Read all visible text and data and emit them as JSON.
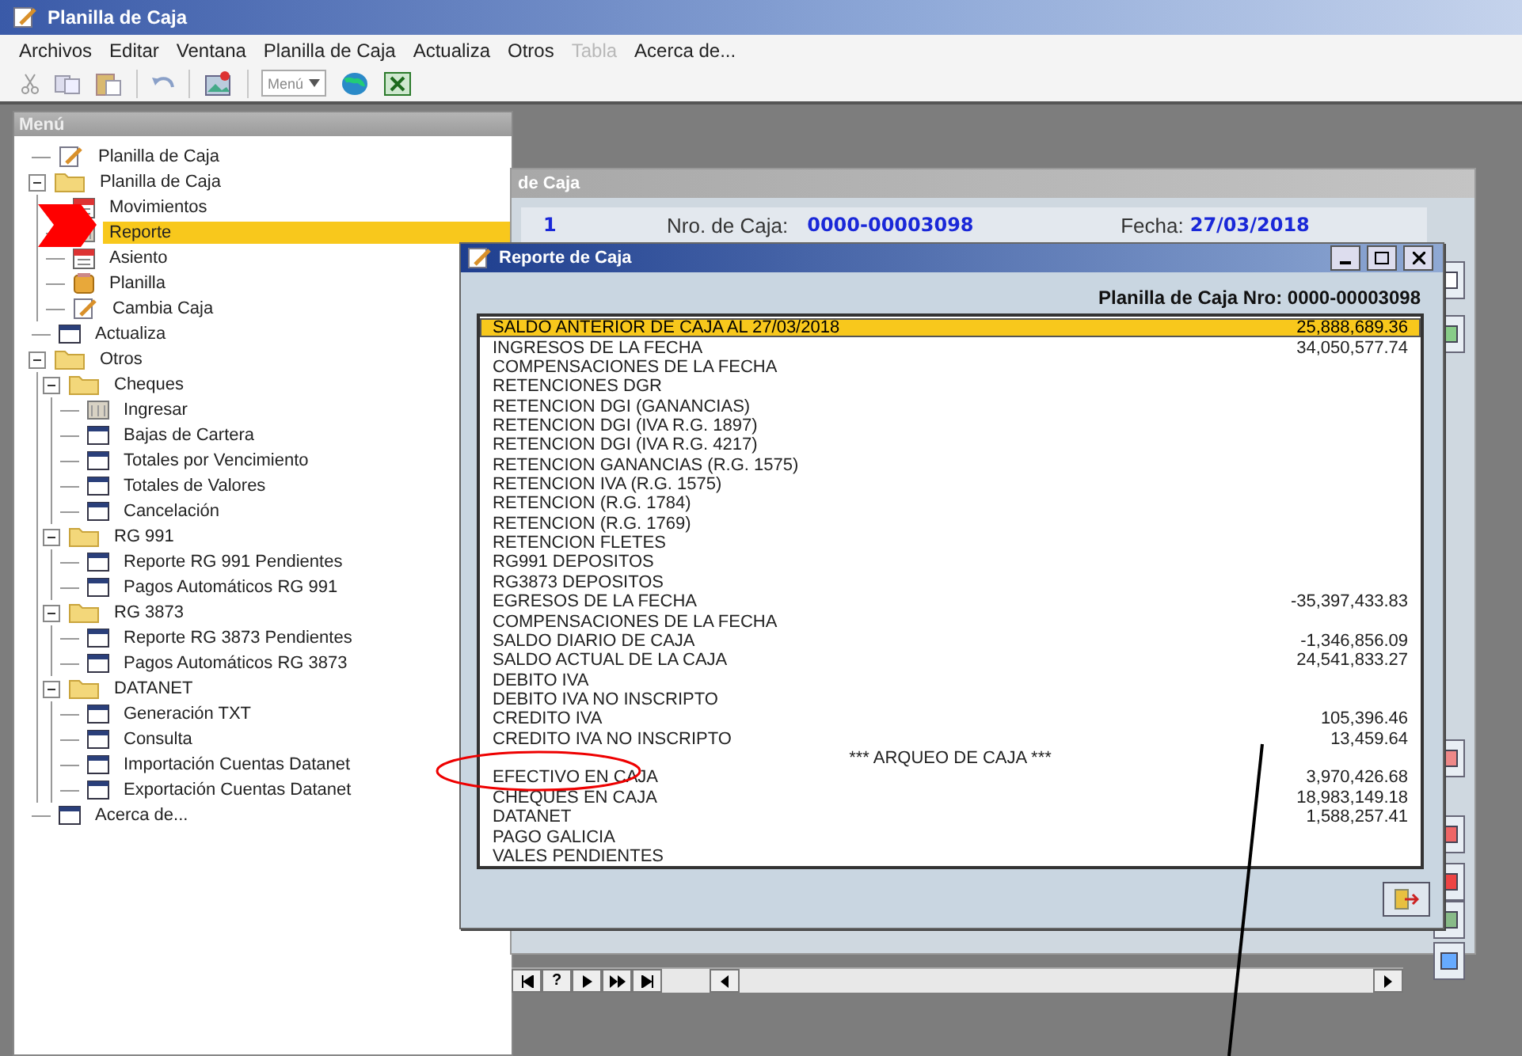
{
  "window": {
    "title": "Planilla de Caja"
  },
  "menubar": [
    {
      "label": "Archivos",
      "disabled": false
    },
    {
      "label": "Editar",
      "disabled": false
    },
    {
      "label": "Ventana",
      "disabled": false
    },
    {
      "label": "Planilla de Caja",
      "disabled": false
    },
    {
      "label": "Actualiza",
      "disabled": false
    },
    {
      "label": "Otros",
      "disabled": false
    },
    {
      "label": "Tabla",
      "disabled": true
    },
    {
      "label": "Acerca de...",
      "disabled": false
    }
  ],
  "toolbar": {
    "menu_dropdown": "Menú"
  },
  "sidebar": {
    "title": "Menú",
    "items": [
      {
        "label": "Planilla de Caja",
        "kind": "document",
        "selected": false
      },
      {
        "label": "Planilla de Caja",
        "kind": "folder",
        "selected": false,
        "expanded": true,
        "children": [
          {
            "label": "Movimientos",
            "kind": "calendar",
            "selected": false
          },
          {
            "label": "Reporte",
            "kind": "card",
            "selected": true
          },
          {
            "label": "Asiento",
            "kind": "calendar",
            "selected": false
          },
          {
            "label": "Planilla",
            "kind": "jar",
            "selected": false
          },
          {
            "label": "Cambia Caja",
            "kind": "document",
            "selected": false
          }
        ]
      },
      {
        "label": "Actualiza",
        "kind": "window",
        "selected": false
      },
      {
        "label": "Otros",
        "kind": "folder",
        "selected": false,
        "expanded": true,
        "children": [
          {
            "label": "Cheques",
            "kind": "folder",
            "selected": false,
            "expanded": true,
            "children": [
              {
                "label": "Ingresar",
                "kind": "card",
                "selected": false
              },
              {
                "label": "Bajas de Cartera",
                "kind": "window",
                "selected": false
              },
              {
                "label": "Totales por Vencimiento",
                "kind": "window",
                "selected": false
              },
              {
                "label": "Totales de Valores",
                "kind": "window",
                "selected": false
              },
              {
                "label": "Cancelación",
                "kind": "window",
                "selected": false
              }
            ]
          },
          {
            "label": "RG 991",
            "kind": "folder",
            "selected": false,
            "expanded": true,
            "children": [
              {
                "label": "Reporte RG 991 Pendientes",
                "kind": "window",
                "selected": false
              },
              {
                "label": "Pagos Automáticos RG 991",
                "kind": "window",
                "selected": false
              }
            ]
          },
          {
            "label": "RG 3873",
            "kind": "folder",
            "selected": false,
            "expanded": true,
            "children": [
              {
                "label": "Reporte RG 3873 Pendientes",
                "kind": "window",
                "selected": false
              },
              {
                "label": "Pagos Automáticos RG 3873",
                "kind": "window",
                "selected": false
              }
            ]
          },
          {
            "label": "DATANET",
            "kind": "folder",
            "selected": false,
            "expanded": true,
            "children": [
              {
                "label": "Generación TXT",
                "kind": "window",
                "selected": false
              },
              {
                "label": "Consulta",
                "kind": "window",
                "selected": false
              },
              {
                "label": "Importación Cuentas Datanet",
                "kind": "window",
                "selected": false
              },
              {
                "label": "Exportación Cuentas Datanet",
                "kind": "window",
                "selected": false
              }
            ]
          }
        ]
      },
      {
        "label": "Acerca de...",
        "kind": "window",
        "selected": false
      }
    ]
  },
  "back_window": {
    "title": "de Caja",
    "number": "1",
    "caja_label": "Nro. de Caja:",
    "caja_value": "0000-00003098",
    "fecha_label": "Fecha:",
    "fecha_value": "27/03/2018",
    "nav_help": "?"
  },
  "report": {
    "title": "Reporte de Caja",
    "header": "Planilla de Caja Nro: 0000-00003098",
    "rows": [
      {
        "kind": "line",
        "label": "SALDO ANTERIOR DE CAJA AL 27/03/2018",
        "value": "25,888,689.36",
        "selected": true
      },
      {
        "kind": "line",
        "label": "INGRESOS DE LA FECHA",
        "value": "34,050,577.74",
        "selected": false
      },
      {
        "kind": "line",
        "label": "COMPENSACIONES DE LA FECHA",
        "selected": false
      },
      {
        "kind": "line",
        "label": "RETENCIONES DGR",
        "selected": false
      },
      {
        "kind": "line",
        "label": "RETENCION DGI (GANANCIAS)",
        "selected": false
      },
      {
        "kind": "line",
        "label": "RETENCION DGI (IVA R.G. 1897)",
        "selected": false
      },
      {
        "kind": "line",
        "label": "RETENCION DGI (IVA R.G. 4217)",
        "selected": false
      },
      {
        "kind": "line",
        "label": "RETENCION GANANCIAS (R.G. 1575)",
        "selected": false
      },
      {
        "kind": "line",
        "label": "RETENCION IVA (R.G. 1575)",
        "selected": false
      },
      {
        "kind": "line",
        "label": "RETENCION (R.G. 1784)",
        "selected": false
      },
      {
        "kind": "line",
        "label": "RETENCION (R.G. 1769)",
        "selected": false
      },
      {
        "kind": "line",
        "label": "RETENCION FLETES",
        "selected": false
      },
      {
        "kind": "line",
        "label": "RG991 DEPOSITOS",
        "selected": false
      },
      {
        "kind": "line",
        "label": "RG3873 DEPOSITOS",
        "selected": false
      },
      {
        "kind": "line",
        "label": "EGRESOS DE LA FECHA",
        "value": "-35,397,433.83",
        "selected": false
      },
      {
        "kind": "line",
        "label": "COMPENSACIONES DE LA FECHA",
        "selected": false
      },
      {
        "kind": "line",
        "label": "SALDO DIARIO DE CAJA",
        "value": "-1,346,856.09",
        "selected": false
      },
      {
        "kind": "line",
        "label": "SALDO ACTUAL DE LA CAJA",
        "value": "24,541,833.27",
        "selected": false
      },
      {
        "kind": "line",
        "label": "DEBITO IVA",
        "selected": false
      },
      {
        "kind": "line",
        "label": "DEBITO IVA NO INSCRIPTO",
        "selected": false
      },
      {
        "kind": "line",
        "label": "CREDITO IVA",
        "value": "105,396.46",
        "selected": false
      },
      {
        "kind": "line",
        "label": "CREDITO IVA NO INSCRIPTO",
        "value": "13,459.64",
        "selected": false
      },
      {
        "kind": "heading",
        "label": "*** ARQUEO DE CAJA ***"
      },
      {
        "kind": "line",
        "label": "EFECTIVO EN CAJA",
        "value": "3,970,426.68",
        "selected": false
      },
      {
        "kind": "line",
        "label": "CHEQUES EN CAJA",
        "value": "18,983,149.18",
        "selected": false
      },
      {
        "kind": "line",
        "label": "DATANET",
        "value": "1,588,257.41",
        "selected": false
      },
      {
        "kind": "line",
        "label": "PAGO GALICIA",
        "selected": false
      },
      {
        "kind": "line",
        "label": "VALES PENDIENTES",
        "selected": false
      }
    ]
  }
}
